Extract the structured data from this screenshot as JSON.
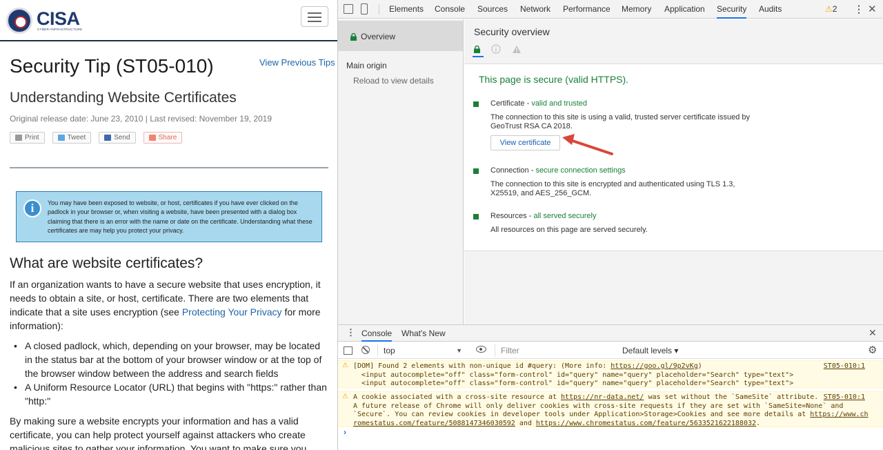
{
  "page": {
    "logo_text": "CISA",
    "logo_sub": "CYBER+INFRASTRUCTURE",
    "title": "Security Tip (ST05-010)",
    "view_previous": "View Previous Tips",
    "subtitle": "Understanding Website Certificates",
    "release": "Original release date: June 23, 2010 | Last revised: November 19, 2019",
    "share": {
      "print": "Print",
      "tweet": "Tweet",
      "send": "Send",
      "share": "Share"
    },
    "notice": "You may have been exposed to website, or host, certificates if you have ever clicked on the padlock in your browser or, when visiting a website, have been presented with a dialog box claiming that there is an error with the name or date on the certificate. Understanding what these certificates are may help you protect your privacy.",
    "heading": "What are website certificates?",
    "para1_a": "If an organization wants to have a secure website that uses encryption, it needs to obtain a site, or host, certificate. There are two elements that indicate that a site uses encryption (see ",
    "para1_link": "Protecting Your Privacy",
    "para1_b": " for more information):",
    "bullet1": "A closed padlock, which, depending on your browser, may be located in the status bar at the bottom of your browser window or at the top of the browser window between the address and search fields",
    "bullet2": "A Uniform Resource Locator (URL) that begins with \"https:\" rather than \"http:\"",
    "para2": "By making sure a website encrypts your information and has a valid certificate, you can help protect yourself against attackers who create malicious sites to gather your information. You want to make sure you know"
  },
  "devtools": {
    "tabs": [
      "Elements",
      "Console",
      "Sources",
      "Network",
      "Performance",
      "Memory",
      "Application",
      "Security",
      "Audits"
    ],
    "active_tab": "Security",
    "warning_count": "2",
    "sidebar": {
      "overview": "Overview",
      "main_origin": "Main origin",
      "reload": "Reload to view details"
    },
    "overview_title": "Security overview",
    "secure_message": "This page is secure (valid HTTPS).",
    "certificate": {
      "title": "Certificate",
      "status": "valid and trusted",
      "desc": "The connection to this site is using a valid, trusted server certificate issued by GeoTrust RSA CA 2018.",
      "button": "View certificate"
    },
    "connection": {
      "title": "Connection",
      "status": "secure connection settings",
      "desc": "The connection to this site is encrypted and authenticated using TLS 1.3, X25519, and AES_256_GCM."
    },
    "resources": {
      "title": "Resources",
      "status": "all served securely",
      "desc": "All resources on this page are served securely."
    },
    "drawer": {
      "tabs": [
        "Console",
        "What's New"
      ],
      "context": "top",
      "filter_placeholder": "Filter",
      "levels": "Default levels ▾"
    },
    "console": {
      "msg1": {
        "text": "[DOM] Found 2 elements with non-unique id #query: (More info: ",
        "link": "https://goo.gl/9p2vKg",
        "tail": ")",
        "source": "ST05-010:1",
        "line2": "<input autocomplete=\"off\" class=\"form-control\" id=\"query\" name=\"query\" placeholder=\"Search\" type=\"text\">",
        "line3": "<input autocomplete=\"off\" class=\"form-control\" id=\"query\" name=\"query\" placeholder=\"Search\" type=\"text\">"
      },
      "msg2": {
        "text_a": "A cookie associated with a cross-site resource at ",
        "link": "https://nr-data.net/",
        "text_b": " was set without the `SameSite` attribute. ",
        "source": "ST05-010:1",
        "line2": "A future release of Chrome will only deliver cookies with cross-site requests if they are set with `SameSite=None` and",
        "line3": "`Secure`. You can review cookies in developer tools under Application>Storage>Cookies and see more details at ",
        "link2": "https://www.ch",
        "line4_link": "romestatus.com/feature/5088147346030592",
        "line4_mid": " and ",
        "line4_link2": "https://www.chromestatus.com/feature/5633521622188032",
        "line4_tail": "."
      }
    }
  }
}
